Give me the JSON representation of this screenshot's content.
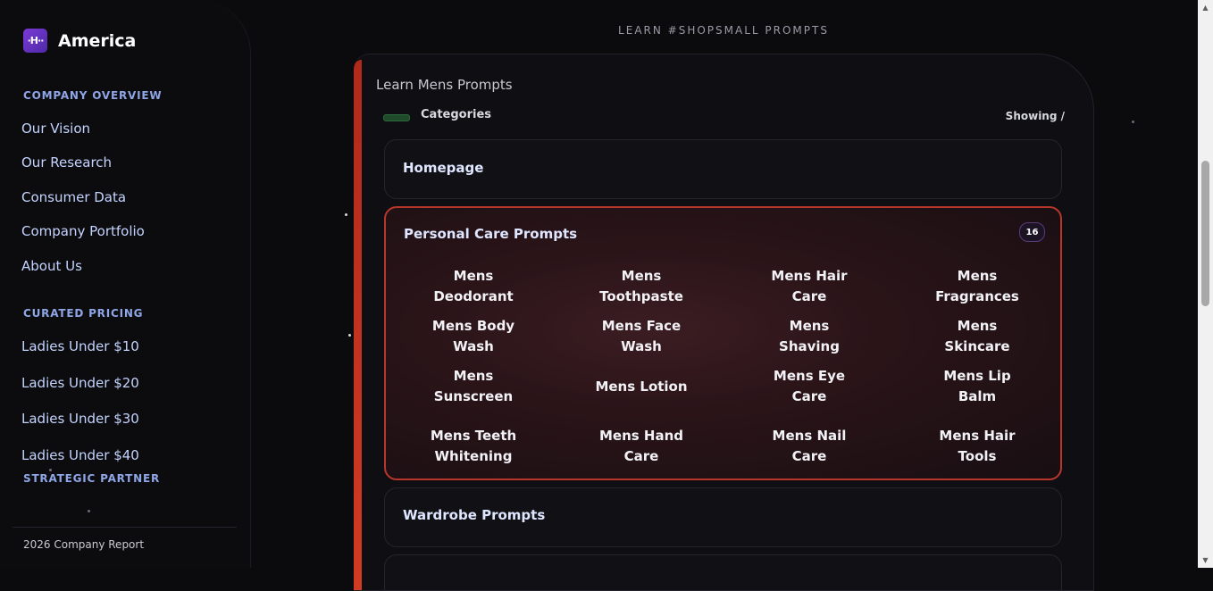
{
  "sidebar": {
    "brand": {
      "logo_text": "·H··",
      "name": "America"
    },
    "sections": [
      {
        "title": "COMPANY OVERVIEW",
        "items": [
          "Our Vision",
          "Our Research",
          "Consumer Data",
          "Company Portfolio",
          "About Us"
        ]
      },
      {
        "title": "CURATED PRICING",
        "items": [
          "Ladies Under $10",
          "Ladies Under $20",
          "Ladies Under $30",
          "Ladies Under $40"
        ]
      },
      {
        "title": "STRATEGIC PARTNER",
        "items": []
      }
    ],
    "footer": "2026 Company Report"
  },
  "main": {
    "heading": "LEARN #SHOPSMALL PROMPTS",
    "panel_title": "Learn Mens Prompts",
    "categories_label": "Categories",
    "showing_label": "Showing /",
    "cards": [
      {
        "title": "Homepage"
      },
      {
        "title": "Personal Care Prompts",
        "count": "16",
        "items": [
          "Mens Deodorant",
          "Mens Toothpaste",
          "Mens Hair Care",
          "Mens Fragrances",
          "Mens Body Wash",
          "Mens Face Wash",
          "Mens Shaving",
          "Mens Skincare",
          "Mens Sunscreen",
          "Mens Lotion",
          "Mens Eye Care",
          "Mens Lip Balm",
          "Mens Teeth Whitening",
          "Mens Hand Care",
          "Mens Nail Care",
          "Mens Hair Tools"
        ]
      },
      {
        "title": "Wardrobe Prompts"
      }
    ]
  },
  "colors": {
    "accent_red": "#d23b23",
    "section_title": "#8fa6e6",
    "nav_link": "#c4d4ff",
    "background": "#0b0a0c"
  }
}
